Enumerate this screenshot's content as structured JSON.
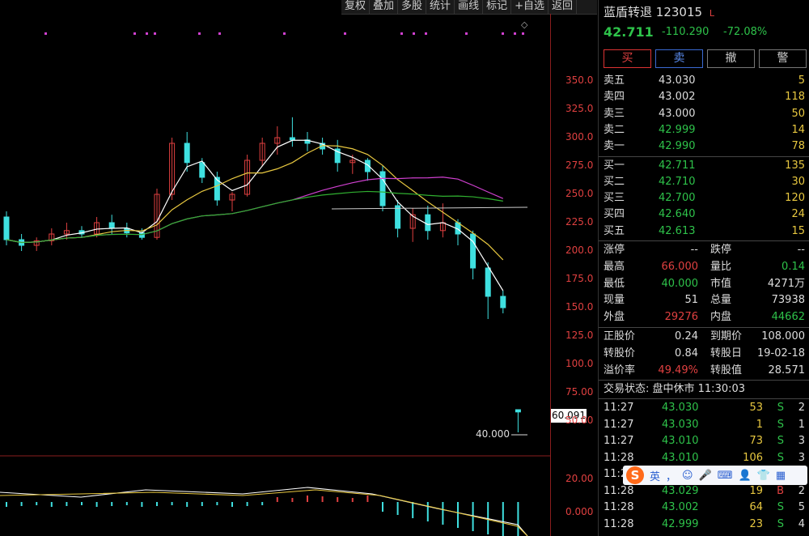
{
  "toolbar": {
    "items": [
      "复权",
      "叠加",
      "多股",
      "统计",
      "画线",
      "标记",
      "+自选",
      "返回"
    ]
  },
  "yaxis": {
    "ticks": [
      "350.0",
      "325.0",
      "300.0",
      "275.0",
      "250.0",
      "225.0",
      "200.0",
      "175.0",
      "150.0",
      "125.0",
      "100.0",
      "75.00",
      "50.00"
    ],
    "current_price_tag": "60.091",
    "macd_ticks": [
      "20.00",
      "0.000"
    ]
  },
  "chart": {
    "low_annotation": "40.000"
  },
  "colors": {
    "up": "#e04040",
    "down": "#3fe0e0",
    "ma_white": "#ffffff",
    "ma_yellow": "#e8c840",
    "ma_magenta": "#d040d0",
    "ma_green": "#30b030"
  },
  "chart_data": {
    "type": "candlestick",
    "price_range": [
      40,
      350
    ],
    "ohlc_approx": [
      [
        230,
        235,
        205,
        210
      ],
      [
        210,
        215,
        200,
        205
      ],
      [
        205,
        212,
        200,
        209
      ],
      [
        209,
        220,
        205,
        215
      ],
      [
        215,
        225,
        210,
        218
      ],
      [
        218,
        222,
        212,
        215
      ],
      [
        215,
        230,
        212,
        225
      ],
      [
        225,
        232,
        215,
        220
      ],
      [
        220,
        225,
        212,
        216
      ],
      [
        216,
        220,
        210,
        212
      ],
      [
        212,
        255,
        210,
        250
      ],
      [
        250,
        300,
        245,
        295
      ],
      [
        295,
        305,
        270,
        278
      ],
      [
        278,
        282,
        260,
        265
      ],
      [
        265,
        270,
        240,
        245
      ],
      [
        245,
        252,
        235,
        250
      ],
      [
        250,
        285,
        248,
        280
      ],
      [
        280,
        300,
        275,
        295
      ],
      [
        295,
        310,
        285,
        300
      ],
      [
        300,
        318,
        292,
        298
      ],
      [
        298,
        305,
        288,
        295
      ],
      [
        295,
        300,
        285,
        290
      ],
      [
        290,
        298,
        270,
        278
      ],
      [
        278,
        285,
        268,
        280
      ],
      [
        280,
        282,
        262,
        270
      ],
      [
        270,
        275,
        235,
        240
      ],
      [
        240,
        245,
        212,
        220
      ],
      [
        220,
        238,
        208,
        232
      ],
      [
        232,
        240,
        210,
        218
      ],
      [
        218,
        242,
        212,
        225
      ],
      [
        225,
        228,
        205,
        215
      ],
      [
        215,
        218,
        175,
        185
      ],
      [
        185,
        190,
        140,
        160
      ],
      [
        160,
        165,
        145,
        150
      ],
      [
        60,
        60,
        40,
        58
      ]
    ]
  },
  "quote": {
    "name": "蓝盾转退",
    "code": "123015",
    "mark": "L",
    "price": "42.711",
    "change": "-110.290",
    "change_pct": "-72.08%",
    "buttons": [
      "买",
      "卖",
      "撤",
      "警"
    ],
    "asks": [
      {
        "label": "卖五",
        "price": "43.030",
        "vol": "5"
      },
      {
        "label": "卖四",
        "price": "43.002",
        "vol": "118"
      },
      {
        "label": "卖三",
        "price": "43.000",
        "vol": "50"
      },
      {
        "label": "卖二",
        "price": "42.999",
        "vol": "14"
      },
      {
        "label": "卖一",
        "price": "42.990",
        "vol": "78"
      }
    ],
    "bids": [
      {
        "label": "买一",
        "price": "42.711",
        "vol": "135"
      },
      {
        "label": "买二",
        "price": "42.710",
        "vol": "30"
      },
      {
        "label": "买三",
        "price": "42.700",
        "vol": "120"
      },
      {
        "label": "买四",
        "price": "42.640",
        "vol": "24"
      },
      {
        "label": "买五",
        "price": "42.613",
        "vol": "15"
      }
    ],
    "stats": [
      {
        "l1": "涨停",
        "v1": "--",
        "l2": "跌停",
        "v2": "--"
      },
      {
        "l1": "最高",
        "v1": "66.000",
        "l2": "量比",
        "v2": "0.14"
      },
      {
        "l1": "最低",
        "v1": "40.000",
        "l2": "市值",
        "v2": "4271万"
      },
      {
        "l1": "现量",
        "v1": "51",
        "l2": "总量",
        "v2": "73938"
      },
      {
        "l1": "外盘",
        "v1": "29276",
        "l2": "内盘",
        "v2": "44662"
      }
    ],
    "bond": [
      {
        "l1": "正股价",
        "v1": "0.24",
        "l2": "到期价",
        "v2": "108.000"
      },
      {
        "l1": "转股价",
        "v1": "0.84",
        "l2": "转股日",
        "v2": "19-02-18"
      },
      {
        "l1": "溢价率",
        "v1": "49.49%",
        "l2": "转股值",
        "v2": "28.571"
      }
    ],
    "status": "交易状态: 盘中休市 11:30:03",
    "ticks": [
      {
        "t": "11:27",
        "p": "43.030",
        "v": "53",
        "s": "S",
        "n": "2"
      },
      {
        "t": "11:27",
        "p": "43.030",
        "v": "1",
        "s": "S",
        "n": "1"
      },
      {
        "t": "11:27",
        "p": "43.010",
        "v": "73",
        "s": "S",
        "n": "3"
      },
      {
        "t": "11:28",
        "p": "43.010",
        "v": "106",
        "s": "S",
        "n": "3"
      },
      {
        "t": "11:28",
        "p": "",
        "v": "",
        "s": "",
        "n": ""
      },
      {
        "t": "11:28",
        "p": "43.029",
        "v": "19",
        "s": "B",
        "n": "2"
      },
      {
        "t": "11:28",
        "p": "43.002",
        "v": "64",
        "s": "S",
        "n": "5"
      },
      {
        "t": "11:28",
        "p": "42.999",
        "v": "23",
        "s": "S",
        "n": "4"
      }
    ]
  },
  "ime": {
    "logo": "S",
    "items": [
      "英",
      "，",
      "☺",
      "🎤",
      "⌨",
      "👤",
      "👕",
      "▦"
    ]
  }
}
